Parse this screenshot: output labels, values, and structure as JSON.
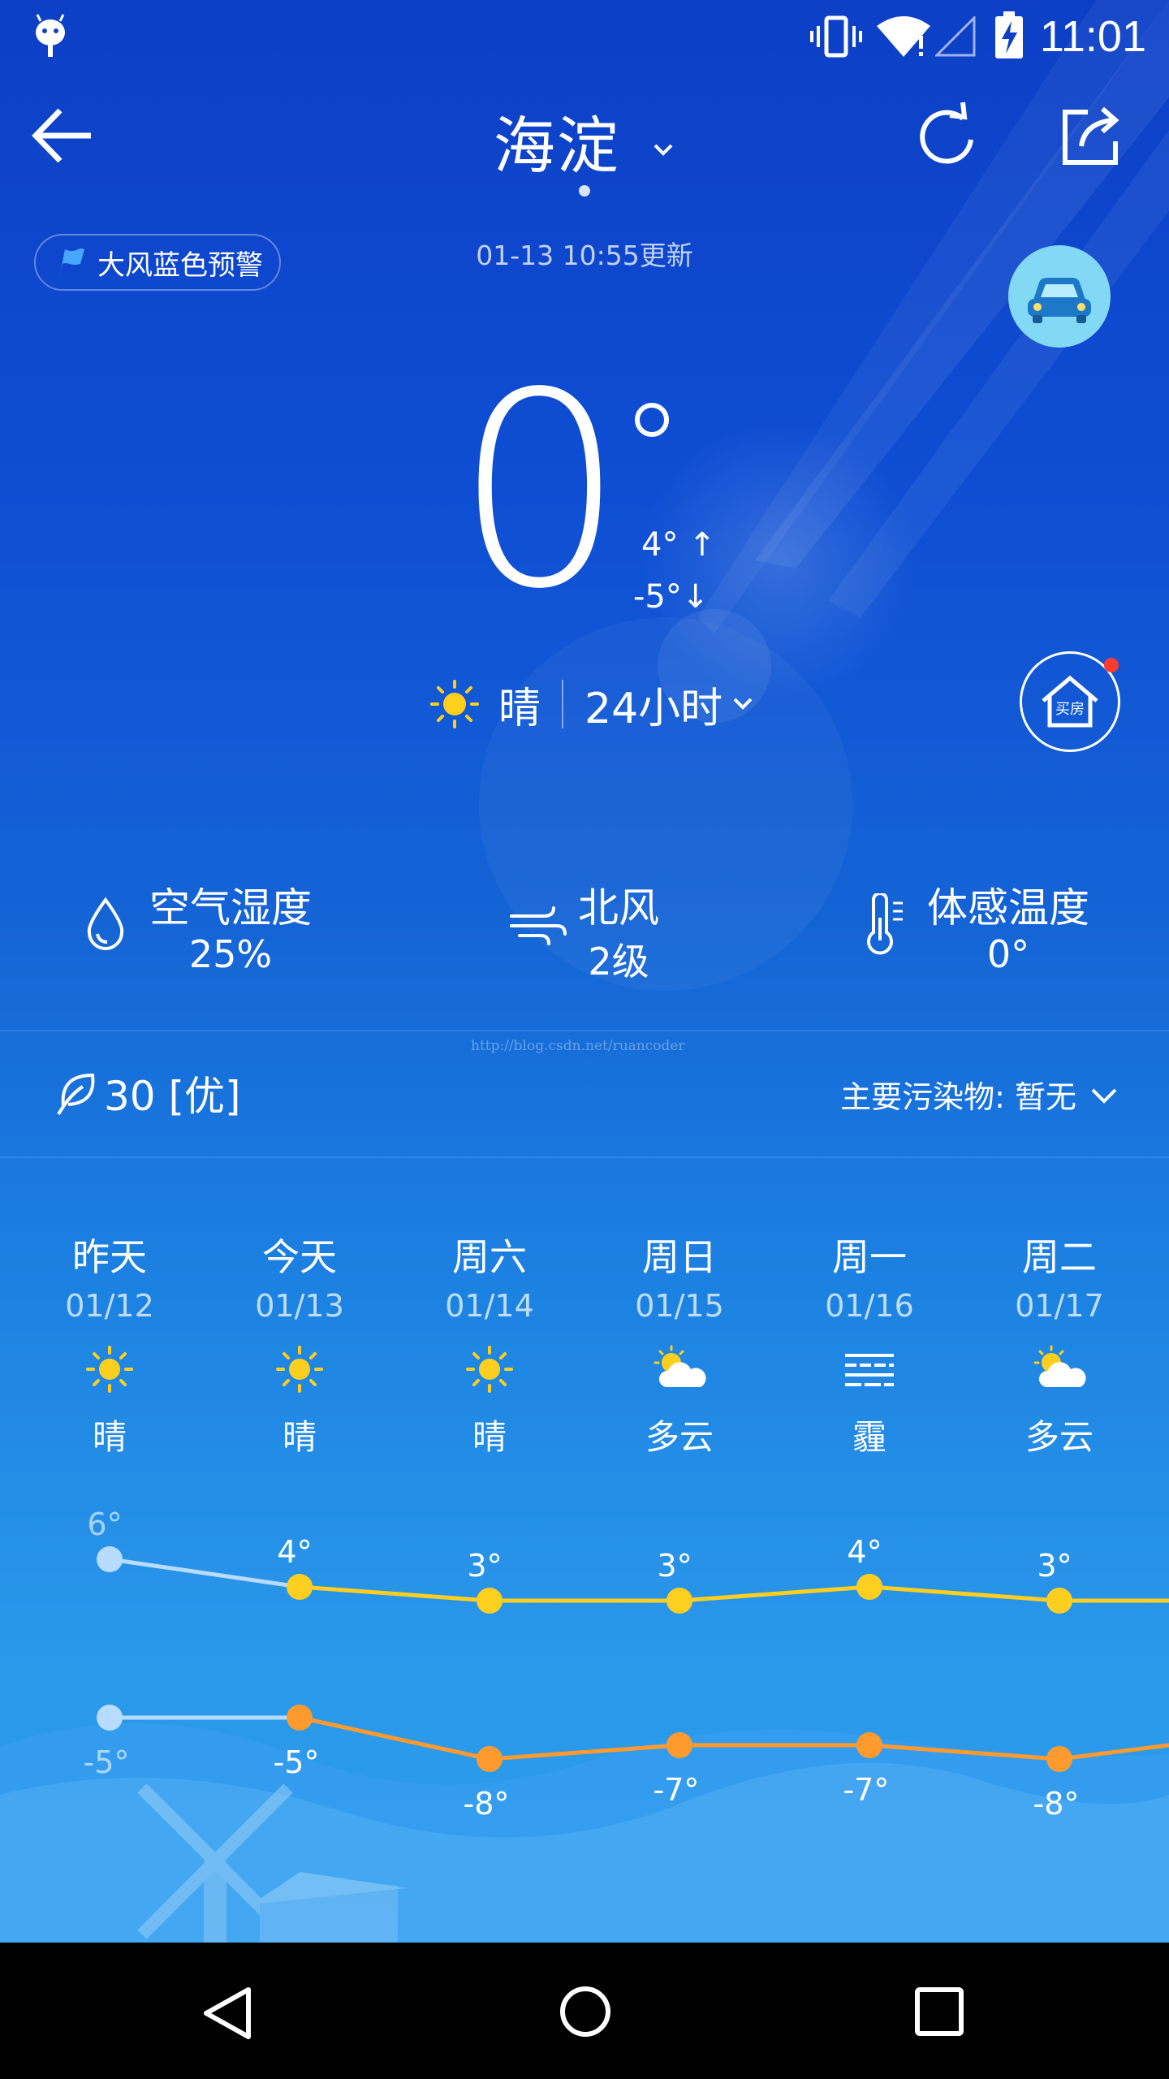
{
  "status_bar": {
    "time": "11:01"
  },
  "header": {
    "city": "海淀",
    "update_time": "01-13 10:55更新"
  },
  "alert": {
    "label": "大风蓝色预警"
  },
  "current": {
    "temperature": "0",
    "high": "4° ↑",
    "low": "-5°↓",
    "condition": "晴",
    "hourly_label": "24小时"
  },
  "house_button": {
    "label": "买房"
  },
  "stats": {
    "humidity": {
      "label": "空气湿度",
      "value": "25%"
    },
    "wind": {
      "label": "北风",
      "value": "2级"
    },
    "feels_like": {
      "label": "体感温度",
      "value": "0°"
    }
  },
  "watermark": "http://blog.csdn.net/ruancoder",
  "aqi": {
    "value": "30 [优]",
    "pollutant": "主要污染物: 暂无"
  },
  "forecast": [
    {
      "day": "昨天",
      "date": "01/12",
      "icon": "sun-icon",
      "weather": "晴"
    },
    {
      "day": "今天",
      "date": "01/13",
      "icon": "sun-icon",
      "weather": "晴"
    },
    {
      "day": "周六",
      "date": "01/14",
      "icon": "sun-icon",
      "weather": "晴"
    },
    {
      "day": "周日",
      "date": "01/15",
      "icon": "partly-cloudy-icon",
      "weather": "多云"
    },
    {
      "day": "周一",
      "date": "01/16",
      "icon": "haze-icon",
      "weather": "霾"
    },
    {
      "day": "周二",
      "date": "01/17",
      "icon": "partly-cloudy-icon",
      "weather": "多云"
    }
  ],
  "chart_data": {
    "type": "line",
    "categories": [
      "昨天",
      "今天",
      "周六",
      "周日",
      "周一",
      "周二"
    ],
    "series": [
      {
        "values": [
          6,
          4,
          3,
          3,
          4,
          3
        ],
        "labels": [
          "6°",
          "4°",
          "3°",
          "3°",
          "4°",
          "3°"
        ]
      },
      {
        "values": [
          -5,
          -5,
          -8,
          -7,
          -7,
          -8
        ],
        "labels": [
          "-5°",
          "-5°",
          "-8°",
          "-7°",
          "-7°",
          "-8°"
        ]
      }
    ],
    "colors": {
      "high": "#ffcf1f",
      "low": "#ff9a2e",
      "past": "#b8dcff"
    }
  }
}
